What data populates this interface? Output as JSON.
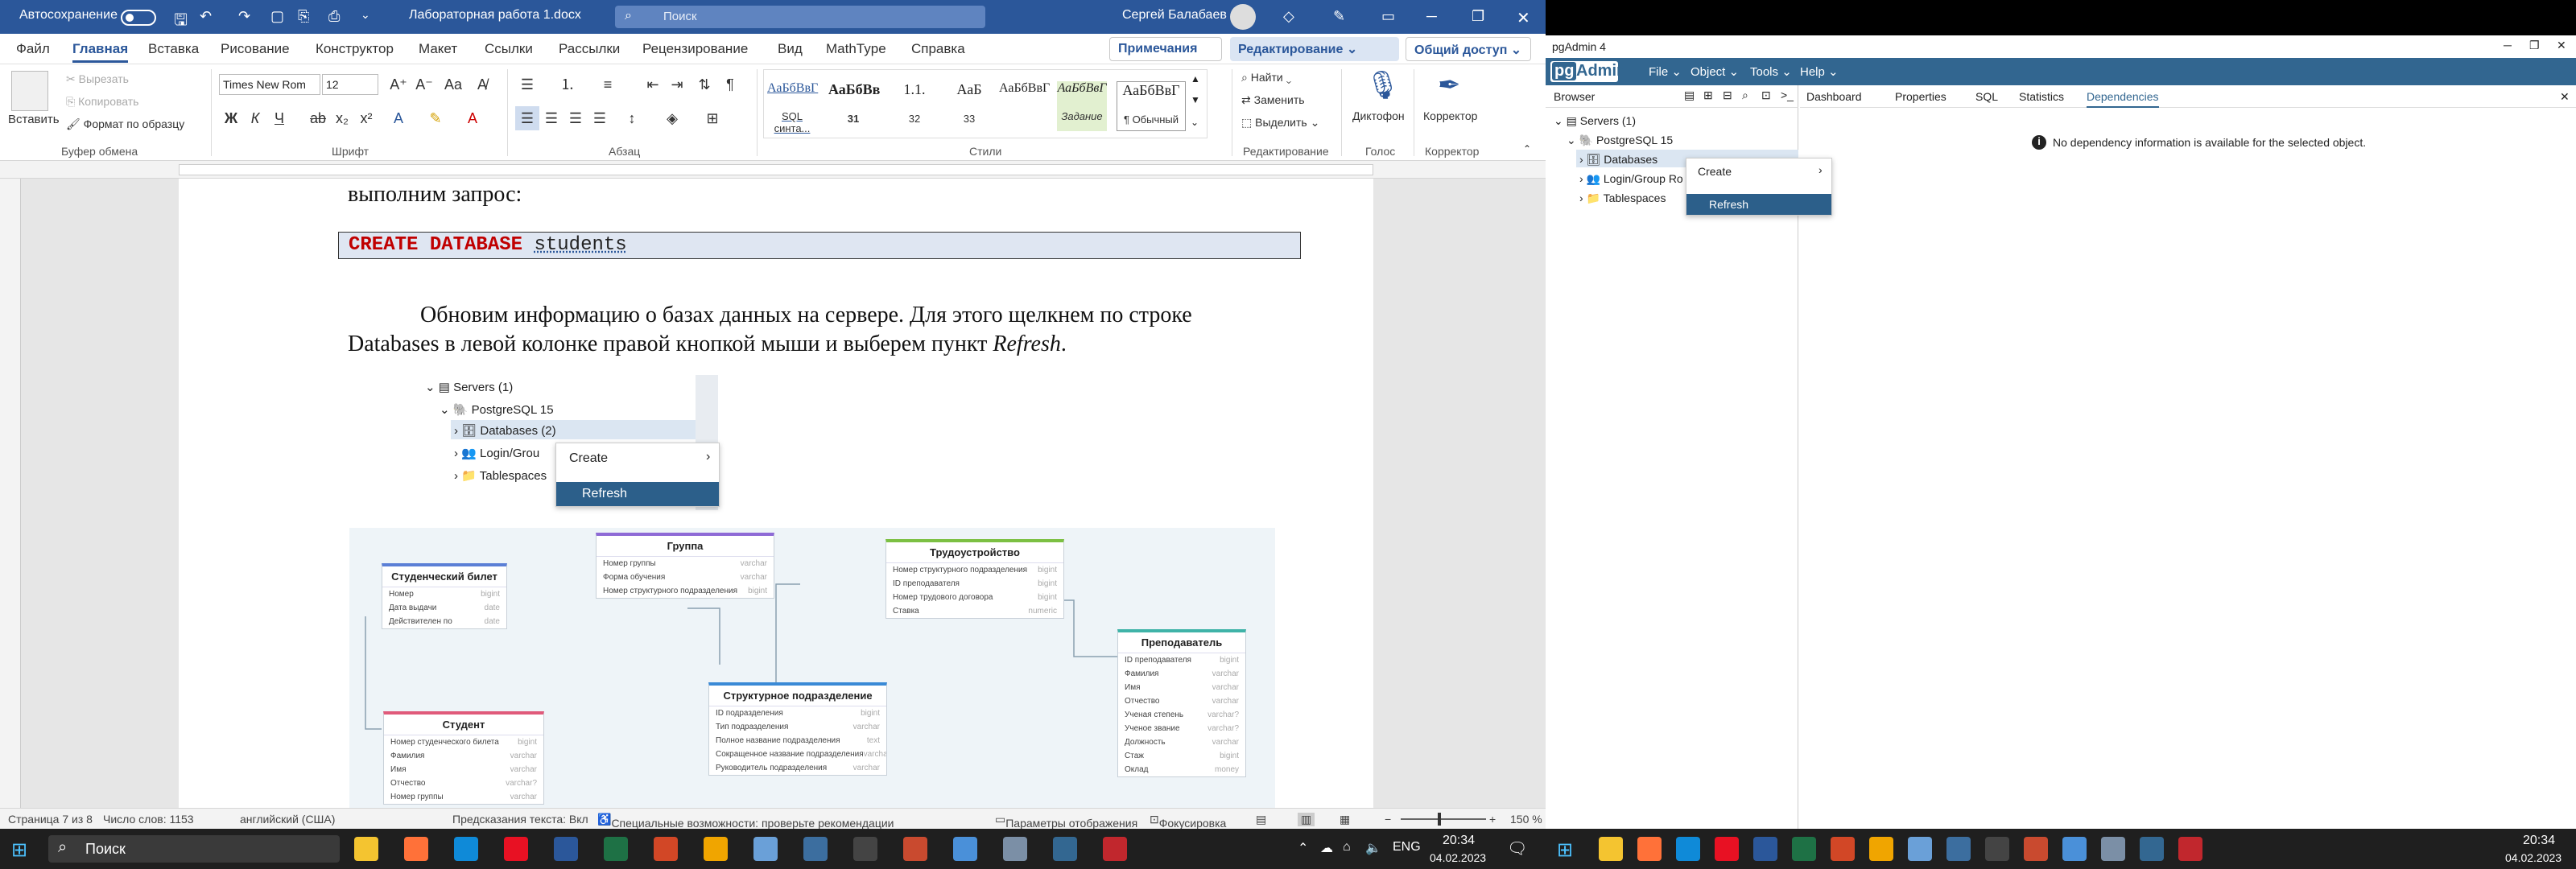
{
  "word": {
    "autosave_label": "Автосохранение",
    "autosave_state": "Откл.",
    "doc_title": "Лабораторная работа 1.docx",
    "search_placeholder": "Поиск",
    "user_name": "Сергей Балабаев",
    "tabs": [
      "Файл",
      "Главная",
      "Вставка",
      "Рисование",
      "Конструктор",
      "Макет",
      "Ссылки",
      "Рассылки",
      "Рецензирование",
      "Вид",
      "MathType",
      "Справка"
    ],
    "active_tab": "Главная",
    "notes_button": "Примечания",
    "editing_button": "Редактирование",
    "share_button": "Общий доступ",
    "ribbon": {
      "paste": "Вставить",
      "cut": "Вырезать",
      "copy": "Копировать",
      "format_painter": "Формат по образцу",
      "clipboard_group": "Буфер обмена",
      "font_name": "Times New Rom",
      "font_size": "12",
      "font_group": "Шрифт",
      "paragraph_group": "Абзац",
      "styles": [
        {
          "preview": "АаБбВвГ",
          "name": "SQL синта..."
        },
        {
          "preview": "АаБбВв",
          "name": "31"
        },
        {
          "preview": "1.1.",
          "name": "32"
        },
        {
          "preview": "АаБ",
          "name": "33"
        },
        {
          "preview": "АаБбВвГ",
          "name": "Задание"
        },
        {
          "preview": "АаБбВвГ",
          "name": "АаБбВвГ"
        },
        {
          "preview": "АаБбВвГ",
          "name": "¶ Обычный"
        }
      ],
      "styles_group": "Стили",
      "find": "Найти",
      "replace": "Заменить",
      "select": "Выделить",
      "editing_group": "Редактирование",
      "dictate": "Диктофон",
      "voice_group": "Голос",
      "editor": "Корректор",
      "editor_group": "Корректор"
    },
    "document": {
      "line1": "выполним запрос:",
      "sql_keyword": "CREATE DATABASE",
      "sql_name": "students",
      "para_part1": "Обновим информацию о базах данных на сервере. Для этого щелкнем по строке",
      "para_part2": "Databases в левой колонке правой кнопкой мыши и выберем пункт",
      "para_italic": "Refresh",
      "para_end": ".",
      "screenshot_tree": {
        "servers": "Servers (1)",
        "pg": "PostgreSQL 15",
        "databases": "Databases (2)",
        "login": "Login/Grou",
        "tablespaces": "Tablespaces",
        "ctx_create": "Create",
        "ctx_refresh": "Refresh"
      },
      "er": {
        "tables": [
          {
            "title": "Студенческий билет",
            "color": "#5b7fd6",
            "rows": [
              [
                "Номер",
                "bigint"
              ],
              [
                "Дата выдачи",
                "date"
              ],
              [
                "Действителен по",
                "date"
              ]
            ]
          },
          {
            "title": "Группа",
            "color": "#8e6ad6",
            "rows": [
              [
                "Номер группы",
                "varchar"
              ],
              [
                "Форма обучения",
                "varchar"
              ],
              [
                "Номер структурного подразделения",
                "bigint"
              ]
            ]
          },
          {
            "title": "Трудоустройство",
            "color": "#7cc043",
            "rows": [
              [
                "Номер структурного подразделения",
                "bigint"
              ],
              [
                "ID преподавателя",
                "bigint"
              ],
              [
                "Номер трудового договора",
                "bigint"
              ],
              [
                "Ставка",
                "numeric"
              ]
            ]
          },
          {
            "title": "Преподаватель",
            "color": "#3fb3a8",
            "rows": [
              [
                "ID преподавателя",
                "bigint"
              ],
              [
                "Фамилия",
                "varchar"
              ],
              [
                "Имя",
                "varchar"
              ],
              [
                "Отчество",
                "varchar"
              ],
              [
                "Ученая степень",
                "varchar?"
              ],
              [
                "Ученое звание",
                "varchar?"
              ],
              [
                "Должность",
                "varchar"
              ],
              [
                "Стаж",
                "bigint"
              ],
              [
                "Оклад",
                "money"
              ]
            ]
          },
          {
            "title": "Структурное подразделение",
            "color": "#3a8ad6",
            "rows": [
              [
                "ID подразделения",
                "bigint"
              ],
              [
                "Тип подразделения",
                "varchar"
              ],
              [
                "Полное название подразделения",
                "text"
              ],
              [
                "Сокращенное название подразделения",
                "varchar"
              ],
              [
                "Руководитель подразделения",
                "varchar"
              ]
            ]
          },
          {
            "title": "Студент",
            "color": "#e05a7a",
            "rows": [
              [
                "Номер студенческого билета",
                "bigint"
              ],
              [
                "Фамилия",
                "varchar"
              ],
              [
                "Имя",
                "varchar"
              ],
              [
                "Отчество",
                "varchar?"
              ],
              [
                "Номер группы",
                "varchar"
              ]
            ]
          }
        ]
      }
    },
    "status": {
      "page": "Страница 7 из 8",
      "words": "Число слов: 1153",
      "lang": "английский (США)",
      "predict": "Предсказания текста: Вкл",
      "access": "Специальные возможности: проверьте рекомендации",
      "display": "Параметры отображения",
      "focus": "Фокусировка",
      "zoom": "150 %"
    }
  },
  "taskbar_left": {
    "search": "Поиск",
    "lang": "ENG",
    "time": "20:34",
    "date": "04.02.2023"
  },
  "taskbar_right": {
    "time": "20:34",
    "date": "04.02.2023"
  },
  "pgadmin": {
    "window_title": "pgAdmin 4",
    "brand_pg": "pg",
    "brand_admin": "Admin",
    "menu": [
      "File",
      "Object",
      "Tools",
      "Help"
    ],
    "browser_title": "Browser",
    "tabs": [
      "Dashboard",
      "Properties",
      "SQL",
      "Statistics",
      "Dependencies"
    ],
    "active_tab": "Dependencies",
    "message": "No dependency information is available for the selected object.",
    "tree": {
      "servers": "Servers (1)",
      "pg": "PostgreSQL 15",
      "databases": "Databases",
      "login": "Login/Group Ro",
      "tablespaces": "Tablespaces"
    },
    "ctx_create": "Create",
    "ctx_refresh": "Refresh"
  },
  "colors": {
    "word_blue": "#2b579a",
    "pg_blue": "#326690",
    "selection": "#2c5f8a",
    "sql_red": "#c00000"
  }
}
